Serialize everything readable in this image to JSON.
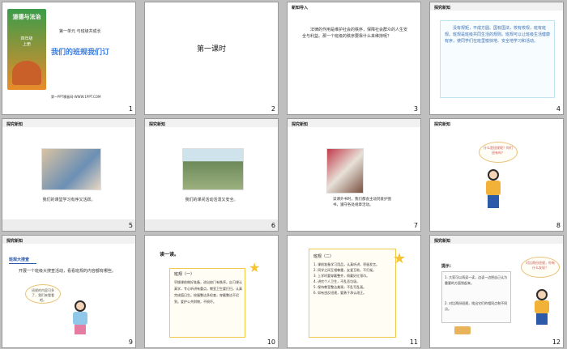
{
  "slides": [
    {
      "number": "1",
      "unit": "第一单元 与班级共成长",
      "title": "我们的班规我们订",
      "footer": "第一PPT模板网-WWW.1PPT.COM",
      "book": {
        "title": "道德与法治",
        "grade": "四年级",
        "volume": "上册"
      }
    },
    {
      "number": "2",
      "title": "第一课时"
    },
    {
      "number": "3",
      "tag": "新知导入",
      "text": "法律的作用是维护社会的秩序，保障社会群众的人生安全与利益。那一个班级的秩序要靠什么来维持呢？"
    },
    {
      "number": "4",
      "tag": "探究新知",
      "text": "没有规矩，不成方圆。国有国法，校有校规，班有班规。班规是班级共同生活的规则。班规可以让班级生活健康有序，使同学们在班里愉快地、安全地学习和活动。"
    },
    {
      "number": "5",
      "tag": "探究新知",
      "caption": "我们的课堂学习有序又活跃。"
    },
    {
      "number": "6",
      "tag": "探究新知",
      "caption": "我们的课间活动活泼又安全。"
    },
    {
      "number": "7",
      "tag": "探究新知",
      "caption": "读课外书时，我们都会主动到爱护图书，遵守各处规章活动。"
    },
    {
      "number": "8",
      "tag": "探究新知",
      "bubble": "什么是班规呢？你们班有吗？"
    },
    {
      "number": "9",
      "tag": "探究新知",
      "heading": "班规大搜查",
      "text": "开展一个班级大搜查活动，看看班规的内容都有哪些。",
      "bubble": "班规的内容可多了，我们来看看吧。"
    },
    {
      "number": "10",
      "heading": "读一读。",
      "box_title": "班规（一）",
      "box_text": "早操课前做好准备，进出校门有秩序。自习课认真学，专心听讲有重点。教室卫生要打扫，认真完成值日生。校服整洁多检查，穿戴整洁不迟到。爱护公共财物，不损坏。"
    },
    {
      "number": "11",
      "box_title": "班规（二）",
      "items": [
        "1. 课前准备学习用品，认真听讲，积极发言。",
        "2. 同学之间互相尊重，友爱互助，不打架。",
        "3. 上学时要穿戴整齐，佩戴好红领巾。",
        "4. 讲究个人卫生，不乱丢垃圾。",
        "5. 保持教室整洁美观，不乱写乱画。",
        "6. 如有违反班规，要勇于承认改正。"
      ]
    },
    {
      "number": "12",
      "tag": "探究新知",
      "tip_title": "提示：",
      "tips": [
        "1. 大家可以再读一读，边读一边把自己认为重要的方面划起来。",
        "2. 对比两份班规，找出它们的相同点和不同点。"
      ],
      "bubble": "对比两份班规，你有什么发现？"
    }
  ],
  "colors": {
    "title_blue": "#3c7de0",
    "accent_red": "#d9534f",
    "box_yellow": "#f0c84a"
  }
}
